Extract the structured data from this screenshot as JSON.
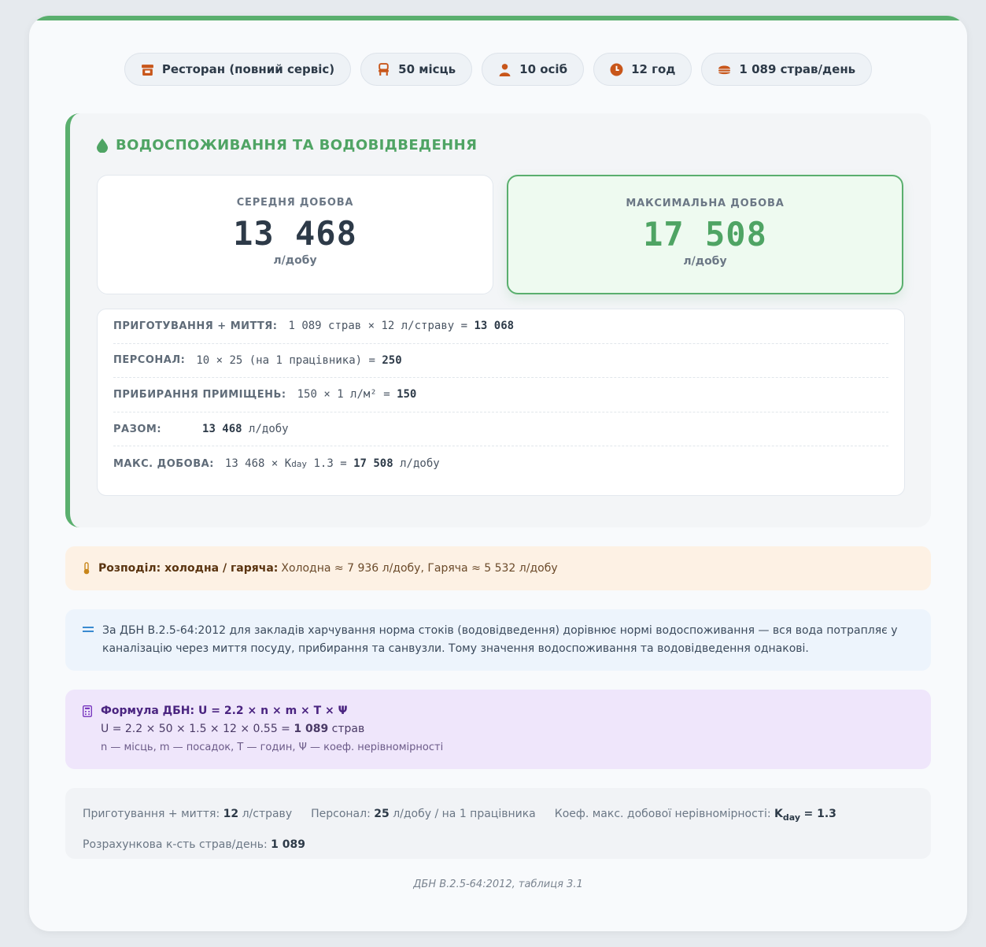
{
  "pills": [
    {
      "icon": "storefront-icon",
      "label": "Ресторан (повний сервіс)"
    },
    {
      "icon": "chair-icon",
      "label": "50 місць"
    },
    {
      "icon": "person-icon",
      "label": "10 осіб"
    },
    {
      "icon": "clock-icon",
      "label": "12 год"
    },
    {
      "icon": "burger-icon",
      "label": "1 089 страв/день"
    }
  ],
  "water": {
    "title": "ВОДОСПОЖИВАННЯ ТА ВОДОВІДВЕДЕННЯ",
    "avg": {
      "label": "СЕРЕДНЯ ДОБОВА",
      "value": "13 468",
      "unit": "л/добу"
    },
    "max": {
      "label": "МАКСИМАЛЬНА ДОБОВА",
      "value": "17 508",
      "unit": "л/добу"
    },
    "rows": {
      "cooking": {
        "label": "ПРИГОТУВАННЯ + МИТТЯ:",
        "expr": "1 089 страв × 12 л/страву =",
        "result": "13 068"
      },
      "staff": {
        "label": "ПЕРСОНАЛ:",
        "expr": "10 × 25 (на 1 працівника) =",
        "result": "250"
      },
      "cleaning": {
        "label": "ПРИБИРАННЯ ПРИМІЩЕНЬ:",
        "expr": "150 × 1 л/м² =",
        "result": "150"
      },
      "total": {
        "label": "РАЗОМ:",
        "result": "13 468",
        "unit": "л/добу"
      },
      "maxday": {
        "label": "МАКС. ДОБОВА:",
        "expr_a": "13 468 × K",
        "sub": "day",
        "expr_b": "1.3 =",
        "result": "17 508",
        "unit": "л/добу"
      }
    }
  },
  "distribution": {
    "label": "Розподіл: холодна / гаряча:",
    "text": "Холодна ≈ 7 936 л/добу, Гаряча ≈ 5 532 л/добу"
  },
  "info": {
    "text": "За ДБН В.2.5-64:2012 для закладів харчування норма стоків (водовідведення) дорівнює нормі водоспоживання — вся вода потрапляє у каналізацію через миття посуду, прибирання та санвузли. Тому значення водоспоживання та водовідведення однакові."
  },
  "formula": {
    "title": "Формула ДБН: U = 2.2 × n × m × T × Ψ",
    "line_expr": "U = 2.2 × 50 × 1.5 × 12 × 0.55 =",
    "line_result": "1 089",
    "line_unit": "страв",
    "legend": "n — місць, m — посадок, T — годин, Ψ — коеф. нерівномірності"
  },
  "params": {
    "cooking_label": "Приготування + миття:",
    "cooking_value": "12",
    "cooking_unit": "л/страву",
    "staff_label": "Персонал:",
    "staff_value": "25",
    "staff_unit": "л/добу / на 1 працівника",
    "coef_label": "Коеф. макс. добової нерівномірності:",
    "coef_k": "K",
    "coef_sub": "day",
    "coef_value": "= 1.3",
    "dishes_label": "Розрахункова к-сть страв/день:",
    "dishes_value": "1 089"
  },
  "source": "ДБН В.2.5-64:2012, таблиця 3.1",
  "colors": {
    "accent": "#5aaf6e",
    "icon": "#c8561a",
    "dist_bg": "#fdf1e4",
    "info_bg": "#edf4fc",
    "formula_bg": "#efe6fb"
  }
}
